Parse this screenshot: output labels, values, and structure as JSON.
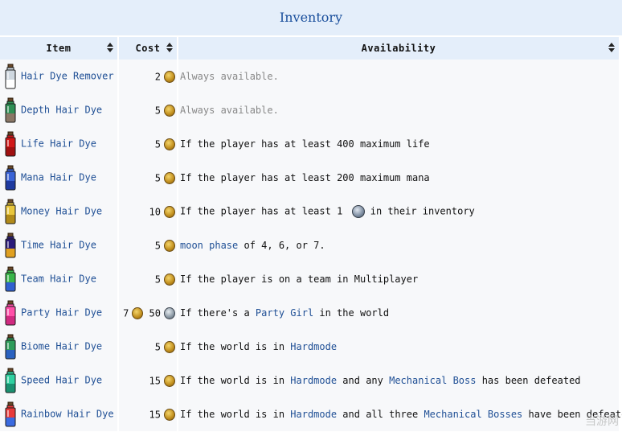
{
  "table": {
    "caption": "Inventory",
    "columns": [
      {
        "label": "Item"
      },
      {
        "label": "Cost"
      },
      {
        "label": "Availability"
      }
    ],
    "rows": [
      {
        "name": "Hair Dye Remover",
        "cost": "2",
        "coins": [
          "gold"
        ],
        "avail": [
          {
            "t": "Always available.",
            "style": "gray"
          }
        ],
        "color_top": "#cfd8e0",
        "color_bottom": "#ffffff"
      },
      {
        "name": "Depth Hair Dye",
        "cost": "5",
        "coins": [
          "gold"
        ],
        "avail": [
          {
            "t": "Always available.",
            "style": "gray"
          }
        ],
        "color_top": "#2f8f55",
        "color_bottom": "#8a7766"
      },
      {
        "name": "Life Hair Dye",
        "cost": "5",
        "coins": [
          "gold"
        ],
        "avail": [
          {
            "t": "If the player has at least 400 maximum life"
          }
        ],
        "color_top": "#d01818",
        "color_bottom": "#a01010"
      },
      {
        "name": "Mana Hair Dye",
        "cost": "5",
        "coins": [
          "gold"
        ],
        "avail": [
          {
            "t": "If the player has at least 200 maximum mana"
          }
        ],
        "color_top": "#3a63d6",
        "color_bottom": "#1e3aa0"
      },
      {
        "name": "Money Hair Dye",
        "cost": "10",
        "coins": [
          "gold"
        ],
        "avail": [
          {
            "t": "If the player has at least 1 "
          },
          {
            "t": "",
            "icon": "plat"
          },
          {
            "t": " in their inventory"
          }
        ],
        "color_top": "#e8c63c",
        "color_bottom": "#b18a1a"
      },
      {
        "name": "Time Hair Dye",
        "cost": "5",
        "coins": [
          "gold"
        ],
        "avail": [
          {
            "t": "moon phase",
            "style": "link"
          },
          {
            "t": " of 4, 6, or 7."
          }
        ],
        "color_top": "#2a1a7a",
        "color_bottom": "#e0a020"
      },
      {
        "name": "Team Hair Dye",
        "cost": "5",
        "coins": [
          "gold"
        ],
        "avail": [
          {
            "t": "If the player is on a team in Multiplayer"
          }
        ],
        "color_top": "#39b54a",
        "color_bottom": "#3060d0"
      },
      {
        "name": "Party Hair Dye",
        "cost": "7",
        "cost2": "50",
        "coins": [
          "gold",
          "silver"
        ],
        "avail": [
          {
            "t": "If there's a "
          },
          {
            "t": "Party Girl",
            "style": "link"
          },
          {
            "t": " in the world"
          }
        ],
        "color_top": "#ff4fa8",
        "color_bottom": "#d02a80"
      },
      {
        "name": "Biome Hair Dye",
        "cost": "5",
        "coins": [
          "gold"
        ],
        "avail": [
          {
            "t": "If the world is in "
          },
          {
            "t": "Hardmode",
            "style": "link"
          }
        ],
        "color_top": "#2e9c5a",
        "color_bottom": "#2a62c0"
      },
      {
        "name": "Speed Hair Dye",
        "cost": "15",
        "coins": [
          "gold"
        ],
        "avail": [
          {
            "t": "If the world is in "
          },
          {
            "t": "Hardmode",
            "style": "link"
          },
          {
            "t": " and any "
          },
          {
            "t": "Mechanical Boss",
            "style": "link"
          },
          {
            "t": " has been defeated"
          }
        ],
        "color_top": "#2fd0a0",
        "color_bottom": "#1a9070"
      },
      {
        "name": "Rainbow Hair Dye",
        "cost": "15",
        "coins": [
          "gold"
        ],
        "avail": [
          {
            "t": "If the world is in "
          },
          {
            "t": "Hardmode",
            "style": "link"
          },
          {
            "t": " and all three "
          },
          {
            "t": "Mechanical Bosses",
            "style": "link"
          },
          {
            "t": " have been defeated"
          }
        ],
        "color_top": "#e83a3a",
        "color_bottom": "#3a6ae0"
      }
    ]
  },
  "watermark": "当游网"
}
